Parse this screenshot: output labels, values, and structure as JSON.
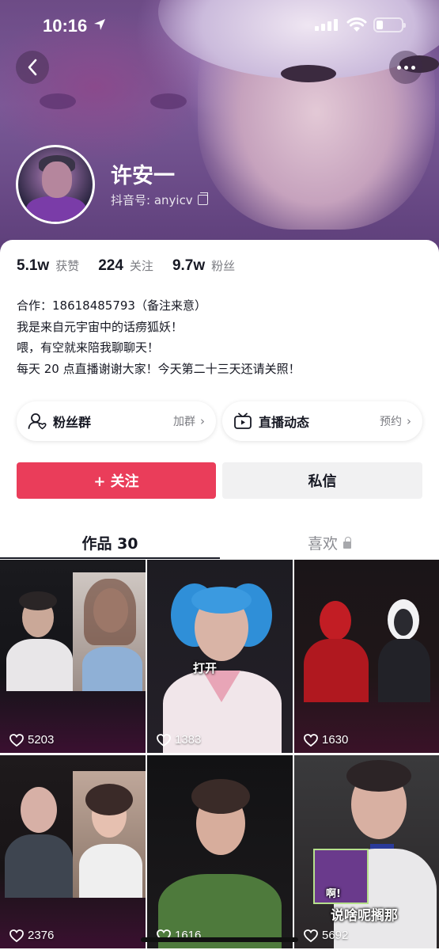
{
  "status_bar": {
    "time": "10:16"
  },
  "profile": {
    "name": "许安一",
    "douyin_id": "抖音号: anyicv",
    "stats": [
      {
        "value": "5.1w",
        "label": "获赞"
      },
      {
        "value": "224",
        "label": "关注"
      },
      {
        "value": "9.7w",
        "label": "粉丝"
      }
    ],
    "bio": [
      "合作：18618485793（备注来意）",
      "我是来自元宇宙中的话痨狐妖！",
      "喂，有空就来陪我聊聊天！",
      "每天 20 点直播谢谢大家！今天第二十三天还请关照！"
    ]
  },
  "pills": {
    "fans": {
      "title": "粉丝群",
      "hint": "加群"
    },
    "live": {
      "title": "直播动态",
      "hint": "预约"
    }
  },
  "actions": {
    "follow": "+ 关注",
    "message": "私信"
  },
  "tabs": {
    "works": "作品 30",
    "likes": "喜欢"
  },
  "videos": [
    {
      "likes": "5203"
    },
    {
      "likes": "1383",
      "caption": "打开"
    },
    {
      "likes": "1630"
    },
    {
      "likes": "2376"
    },
    {
      "likes": "1616"
    },
    {
      "likes": "5692",
      "caption": "说啥呢搁那",
      "caption2": "啊!"
    }
  ],
  "colors": {
    "accent": "#ea3d5a",
    "text": "#161823",
    "muted": "#7b7c82"
  }
}
